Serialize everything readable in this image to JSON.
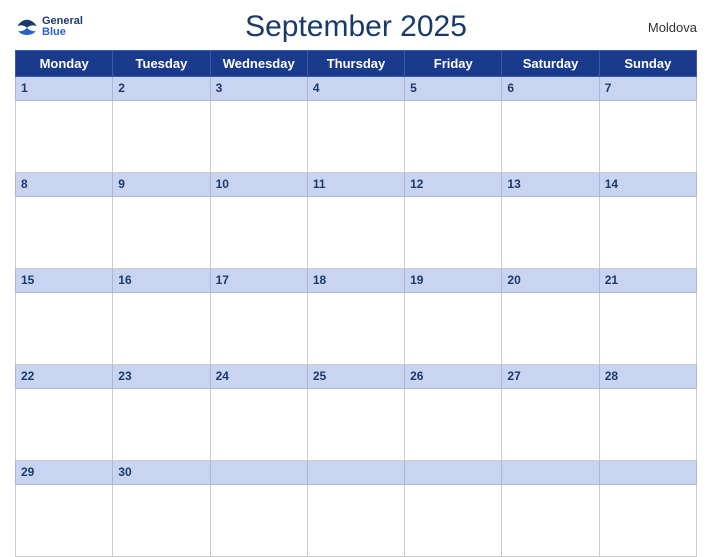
{
  "header": {
    "title": "September 2025",
    "country": "Moldova",
    "logo": {
      "general": "General",
      "blue": "Blue"
    }
  },
  "days": [
    "Monday",
    "Tuesday",
    "Wednesday",
    "Thursday",
    "Friday",
    "Saturday",
    "Sunday"
  ],
  "weeks": [
    [
      1,
      2,
      3,
      4,
      5,
      6,
      7
    ],
    [
      8,
      9,
      10,
      11,
      12,
      13,
      14
    ],
    [
      15,
      16,
      17,
      18,
      19,
      20,
      21
    ],
    [
      22,
      23,
      24,
      25,
      26,
      27,
      28
    ],
    [
      29,
      30,
      null,
      null,
      null,
      null,
      null
    ]
  ],
  "colors": {
    "header_bg": "#1a3a8c",
    "date_row_bg": "#c8d4f0",
    "title_color": "#1a3a6b",
    "cell_border": "#ccc"
  }
}
